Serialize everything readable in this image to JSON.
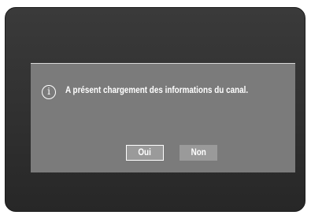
{
  "dialog": {
    "icon": "info-icon",
    "icon_glyph": "i",
    "message": "A présent chargement des informations du canal.",
    "buttons": {
      "yes_label": "Oui",
      "no_label": "Non"
    }
  },
  "colors": {
    "screen_background": "#333333",
    "dialog_background": "#7b7b7b",
    "button_background": "#9a9a9a",
    "text": "#ffffff"
  }
}
